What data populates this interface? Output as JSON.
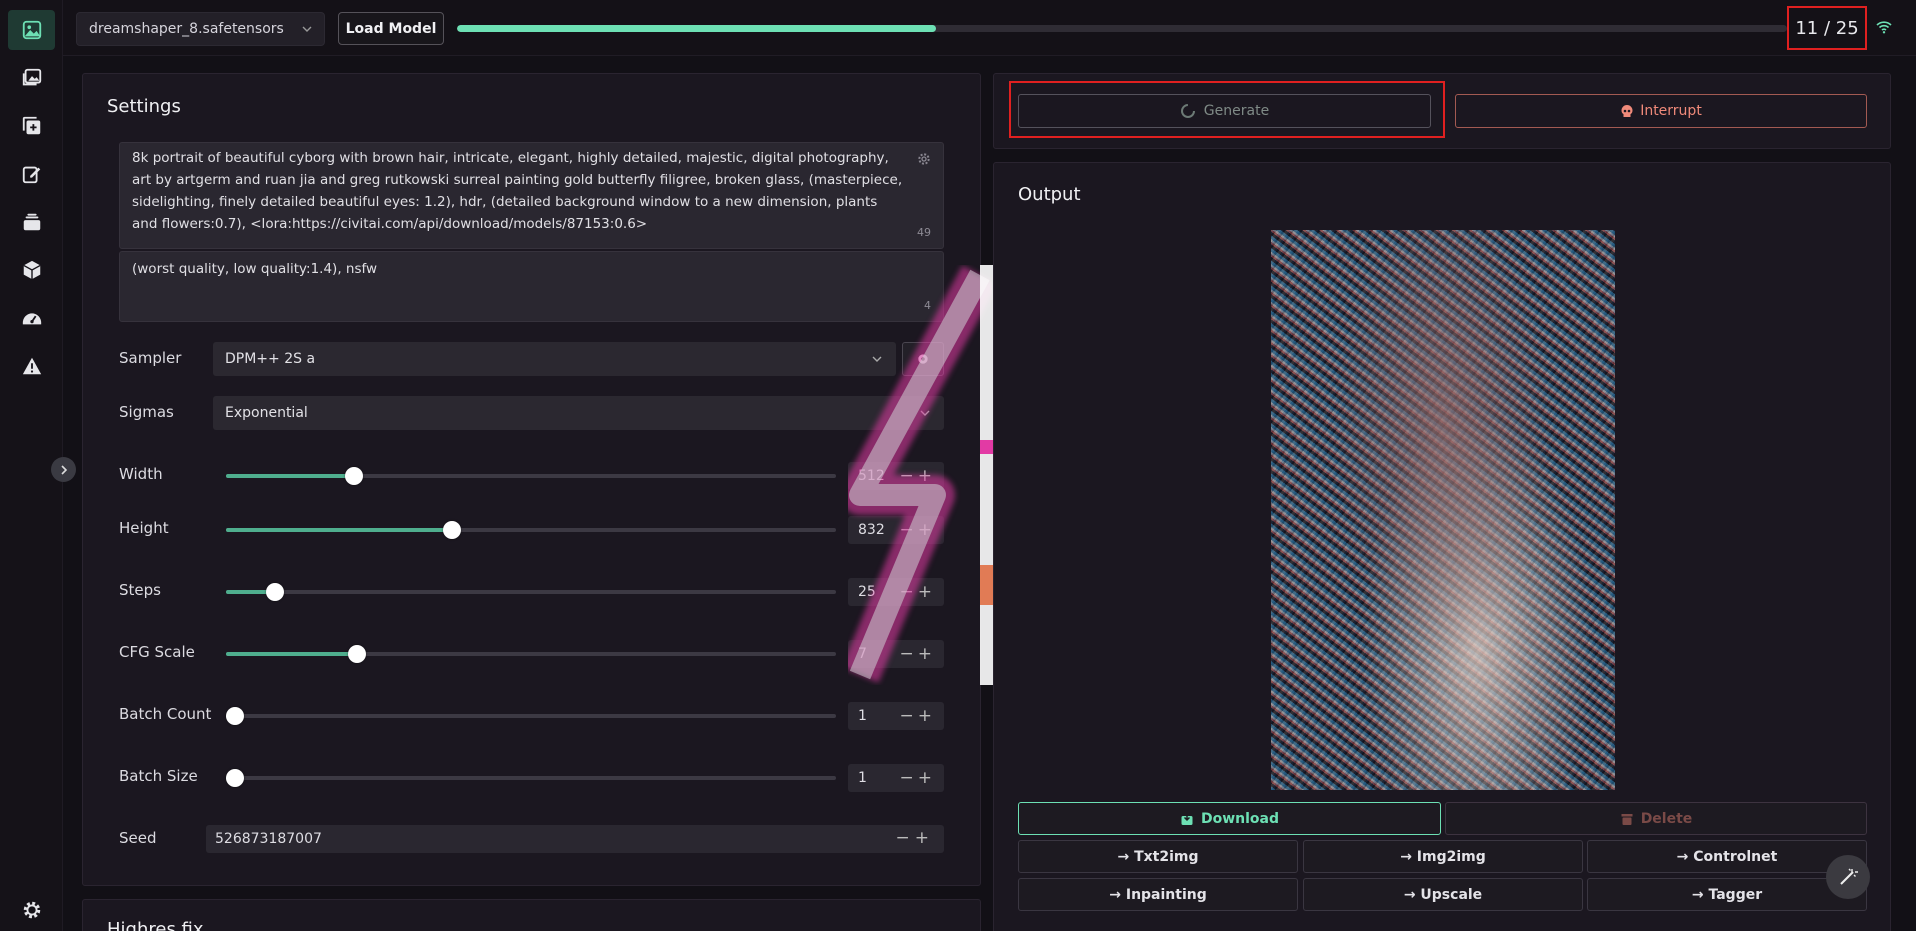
{
  "topbar": {
    "model": "dreamshaper_8.safetensors",
    "load_model": "Load Model",
    "progress_fraction": 0.36,
    "step_counter": "11 / 25"
  },
  "settings": {
    "title": "Settings",
    "prompt": "8k portrait of beautiful cyborg with brown hair, intricate, elegant, highly detailed, majestic, digital photography, art by artgerm and ruan jia and greg rutkowski surreal painting gold butterfly filigree, broken glass, (masterpiece, sidelighting, finely detailed beautiful eyes: 1.2), hdr, (detailed background window to a new dimension, plants and flowers:0.7), <lora:https://civitai.com/api/download/models/87153:0.6>",
    "prompt_count": "49",
    "negative_prompt": "(worst quality, low quality:1.4), nsfw",
    "negative_count": "4",
    "sampler_label": "Sampler",
    "sampler_value": "DPM++ 2S a",
    "sigmas_label": "Sigmas",
    "sigmas_value": "Exponential",
    "sliders": [
      {
        "label": "Width",
        "value": "512",
        "fraction": 0.21
      },
      {
        "label": "Height",
        "value": "832",
        "fraction": 0.37
      },
      {
        "label": "Steps",
        "value": "25",
        "fraction": 0.08
      },
      {
        "label": "CFG Scale",
        "value": "7",
        "fraction": 0.215
      },
      {
        "label": "Batch Count",
        "value": "1",
        "fraction": 0.015
      },
      {
        "label": "Batch Size",
        "value": "1",
        "fraction": 0.015
      }
    ],
    "seed_label": "Seed",
    "seed_value": "526873187007",
    "next_section": "Highres fix"
  },
  "controls": {
    "generate": "Generate",
    "interrupt": "Interrupt"
  },
  "output": {
    "title": "Output",
    "download": "Download",
    "delete": "Delete",
    "send_to": [
      "→ Txt2img",
      "→ Img2img",
      "→ Controlnet",
      "→ Inpainting",
      "→ Upscale",
      "→ Tagger"
    ]
  },
  "colors": {
    "accent": "#6de0b4",
    "interrupt": "#f08a7a",
    "highlight": "#e02020"
  }
}
